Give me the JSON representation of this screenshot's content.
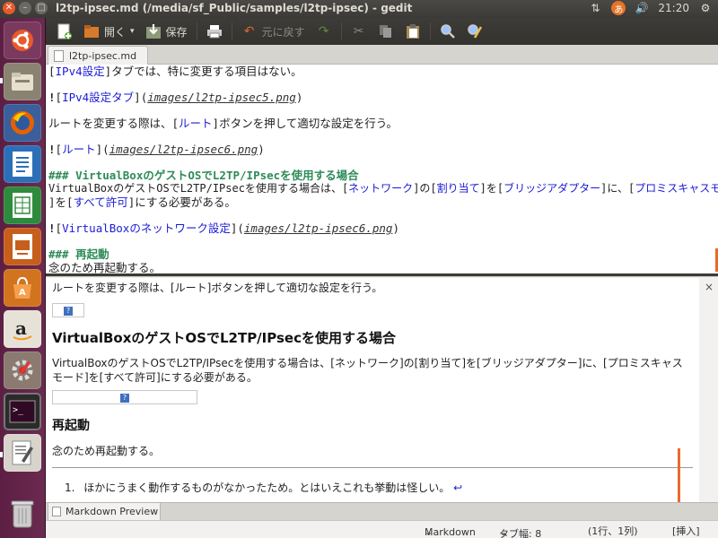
{
  "window": {
    "title": "l2tp-ipsec.md (/media/sf_Public/samples/l2tp-ipsec) - gedit"
  },
  "indicators": {
    "ime_label": "あ",
    "clock": "21:20"
  },
  "launcher": {
    "items": [
      "ubuntu-dash",
      "files",
      "firefox",
      "writer",
      "calc",
      "impress",
      "software-center",
      "amazon",
      "system-settings",
      "terminal",
      "text-editor",
      "trash"
    ]
  },
  "toolbar": {
    "open_label": "開く",
    "save_label": "保存",
    "undo_label": "元に戻す"
  },
  "tab": {
    "label": "l2tp-ipsec.md"
  },
  "editor": {
    "l1": {
      "b1": "[",
      "t1": "IPv4設定",
      "b2": "]タブでは、特に変更する項目はない。"
    },
    "l2": {
      "bang": "!",
      "b1": "[",
      "t1": "IPv4設定タブ",
      "b2": "](",
      "url": "images/l2tp-ipsec5.png",
      "b3": ")"
    },
    "l3": {
      "pre": "ルートを変更する際は、[",
      "t1": "ルート",
      "post": "]ボタンを押して適切な設定を行う。"
    },
    "l4": {
      "bang": "!",
      "b1": "[",
      "t1": "ルート",
      "b2": "](",
      "url": "images/l2tp-ipsec6.png",
      "b3": ")"
    },
    "l5": {
      "heading": "### VirtualBoxのゲストOSでL2TP/IPsecを使用する場合"
    },
    "l6": {
      "pre": "VirtualBoxのゲストOSでL2TP/IPsecを使用する場合は、[",
      "t1": "ネットワーク",
      "m1": "]の[",
      "t2": "割り当て",
      "m2": "]を[",
      "t3": "ブリッジアダプター",
      "m3": "]に、[",
      "t4": "プロミスキャスモード"
    },
    "l7": {
      "pre": "]を[",
      "t1": "すべて許可",
      "post": "]にする必要がある。"
    },
    "l8": {
      "bang": "!",
      "b1": "[",
      "t1": "VirtualBoxのネットワーク設定",
      "b2": "](",
      "url": "images/l2tp-ipsec6.png",
      "b3": ")"
    },
    "l9": {
      "heading": "### 再起動"
    },
    "l10": {
      "text": "念のため再起動する。"
    }
  },
  "preview": {
    "para1": "ルートを変更する際は、[ルート]ボタンを押して適切な設定を行う。",
    "heading1": "VirtualBoxのゲストOSでL2TP/IPsecを使用する場合",
    "para2": "VirtualBoxのゲストOSでL2TP/IPsecを使用する場合は、[ネットワーク]の[割り当て]を[ブリッジアダプター]に、[プロミスキャスモード]を[すべて許可]にする必要がある。",
    "heading2": "再起動",
    "para3": "念のため再起動する。",
    "footnote_num": "1.",
    "footnote": "ほかにうまく動作するものがなかったため。とはいえこれも挙動は怪しい。",
    "footnote_back": "↩",
    "close": "×",
    "img_icon": "?"
  },
  "bottom_panel": {
    "tab_label": "Markdown Preview"
  },
  "statusbar": {
    "language": "Markdown",
    "tab_width": "タブ幅: 8",
    "position": "(1行、1列)",
    "mode": "[挿入]"
  },
  "colors": {
    "accent": "#e86a2f",
    "launcher": "#5c1f43",
    "link": "#1a1ad6",
    "heading_md": "#2e8b57"
  }
}
